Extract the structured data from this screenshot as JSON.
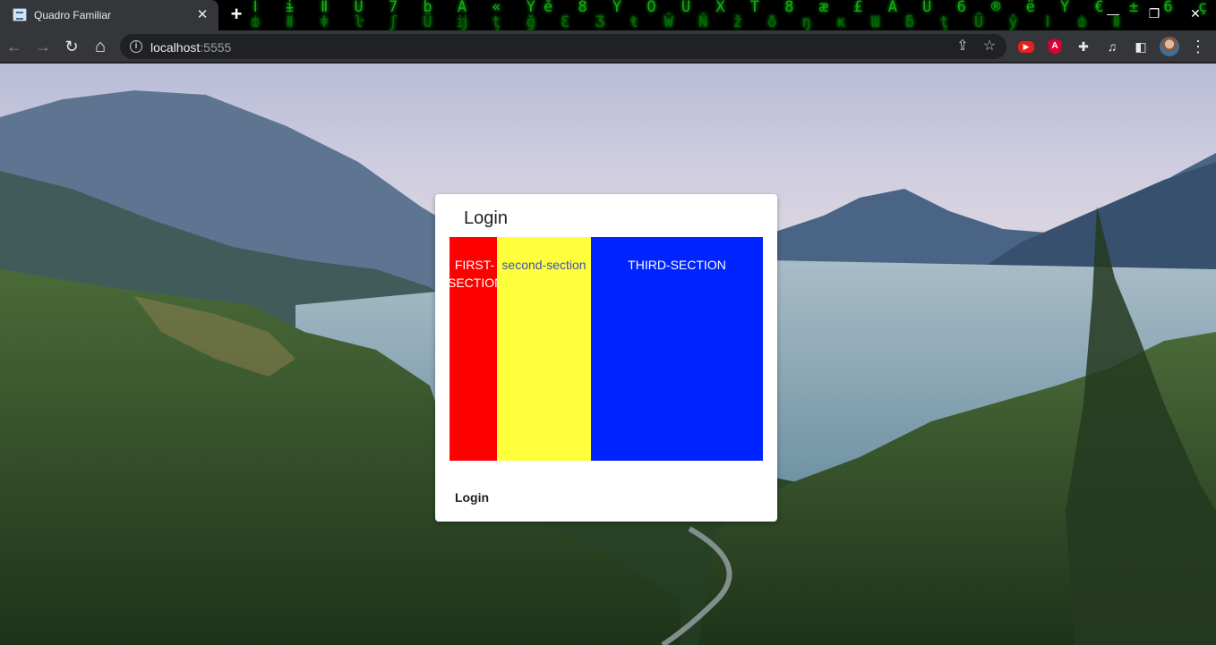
{
  "browser": {
    "tab": {
      "title": "Quadro Familiar",
      "close_glyph": "✕"
    },
    "new_tab_glyph": "+",
    "window_controls": {
      "minimize": "—",
      "restore": "❐",
      "close": "✕"
    },
    "toolbar": {
      "back_glyph": "←",
      "forward_glyph": "→",
      "reload_glyph": "↻",
      "home_glyph": "⌂",
      "url_host": "localhost",
      "url_port": ":5555",
      "share_glyph": "⇪",
      "bookmark_glyph": "☆",
      "extensions": [
        {
          "name": "youtube-extension-icon",
          "glyph": "▶"
        },
        {
          "name": "angular-devtools-icon",
          "glyph": "A"
        },
        {
          "name": "puzzle-extensions-icon",
          "glyph": "✚"
        },
        {
          "name": "media-control-icon",
          "glyph": "♫"
        },
        {
          "name": "side-panel-icon",
          "glyph": "◧"
        }
      ],
      "menu_glyph": "⋮"
    },
    "theme_matrix_rows": [
      "ǀ ɨ ǁ U 7 b Â « Ýě 8 Ÿ Ö Ü X T 8 æ £ Â U 6 ® ë Ý € ± 6 ç",
      "ȸ ǁ ǂ ŀ ʃ Ü ĳ ţ ğ Ɛ Ʒ ŧ Ŵ Ň ž ð ŋ ĸ Ɯ ƃ ţ Ū ŷ ǀ ȸ ǁ"
    ]
  },
  "login_card": {
    "title": "Login",
    "sections": {
      "first": "FIRST-SECTION",
      "second": "second-section",
      "third": "THIRD-SECTION"
    },
    "login_button": "Login"
  },
  "colors": {
    "first_section": "#ff0000",
    "second_section": "#ffff3b",
    "third_section": "#0024ff",
    "second_section_text": "#3f51b5"
  }
}
